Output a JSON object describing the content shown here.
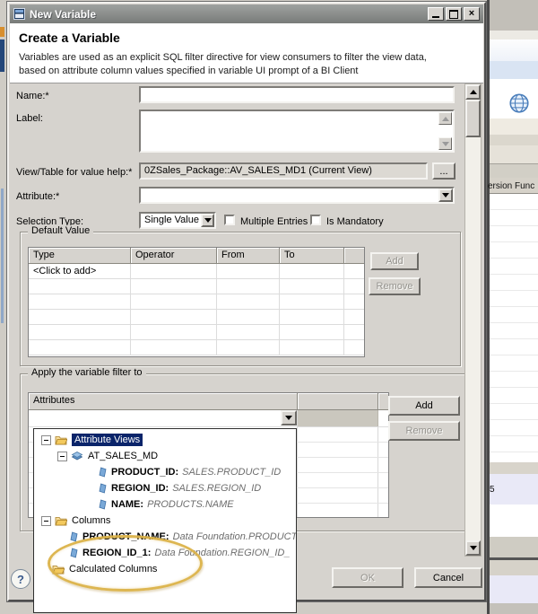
{
  "window": {
    "title": "New Variable"
  },
  "header": {
    "title": "Create a Variable",
    "description": "Variables are used as an explicit SQL filter directive for view consumers to filter the view data, based on attribute column values specified in variable UI prompt of a BI Client"
  },
  "form": {
    "name_label": "Name:*",
    "label_label": "Label:",
    "view_table_label": "View/Table for value help:*",
    "view_table_value": "0ZSales_Package::AV_SALES_MD1 (Current View)",
    "browse_button": "...",
    "attribute_label": "Attribute:*",
    "selection_type_label": "Selection Type:",
    "selection_type_value": "Single Value",
    "multiple_entries_label": "Multiple Entries",
    "is_mandatory_label": "Is Mandatory"
  },
  "default_value": {
    "legend": "Default Value",
    "columns": [
      "Type",
      "Operator",
      "From",
      "To"
    ],
    "first_row": "<Click to add>",
    "add_button": "Add",
    "remove_button": "Remove"
  },
  "apply_filter": {
    "legend": "Apply the variable filter to",
    "column_header": "Attributes",
    "add_button": "Add",
    "remove_button": "Remove"
  },
  "tree": {
    "items": [
      {
        "label": "Attribute Views",
        "type": "folder",
        "selected": true
      },
      {
        "label": "AT_SALES_MD",
        "type": "attribute-view"
      },
      {
        "label": "PRODUCT_ID:",
        "detail": "SALES.PRODUCT_ID",
        "type": "attribute"
      },
      {
        "label": "REGION_ID:",
        "detail": "SALES.REGION_ID",
        "type": "attribute"
      },
      {
        "label": "NAME:",
        "detail": "PRODUCTS.NAME",
        "type": "attribute"
      },
      {
        "label": "Columns",
        "type": "folder"
      },
      {
        "label": "PRODUCT_NAME:",
        "detail": "Data Foundation.PRODUCT",
        "type": "attribute"
      },
      {
        "label": "REGION_ID_1:",
        "detail": "Data Foundation.REGION_ID_",
        "type": "attribute"
      },
      {
        "label": "Calculated Columns",
        "type": "folder"
      }
    ]
  },
  "footer": {
    "help": "?",
    "ok": "OK",
    "cancel": "Cancel"
  },
  "background": {
    "partial_column_header": "ersion Func",
    "partial_text": "5"
  },
  "colors": {
    "selection": "#0a246a",
    "annotation": "#dbb248",
    "dialog_bg": "#d6d3ce",
    "titlebar": "#8a8d8a"
  }
}
